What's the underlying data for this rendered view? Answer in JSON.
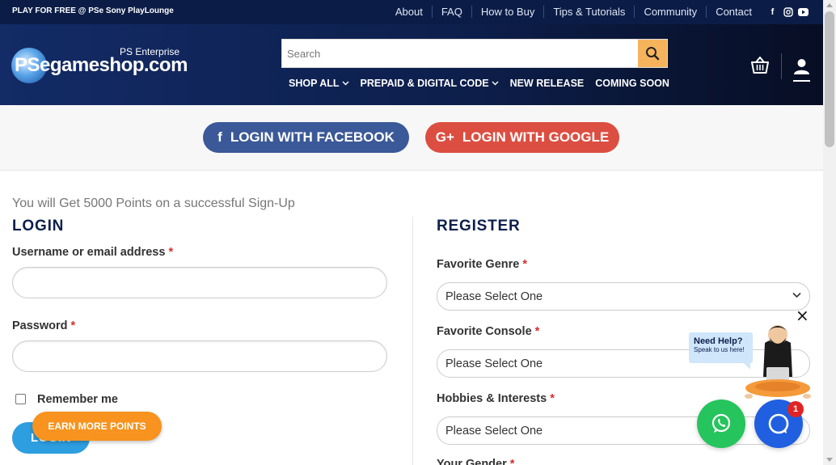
{
  "topbar": {
    "promo": "PLAY FOR FREE @ PSe Sony PlayLounge",
    "links": [
      "About",
      "FAQ",
      "How to Buy",
      "Tips & Tutorials",
      "Community",
      "Contact"
    ],
    "social": [
      "facebook-icon",
      "instagram-icon",
      "youtube-icon"
    ]
  },
  "header": {
    "logo_sub": "PS Enterprise",
    "logo_name": "PSegameshop.com",
    "search_placeholder": "Search",
    "nav": [
      "SHOP ALL",
      "PREPAID & DIGITAL CODE",
      "NEW RELEASE",
      "COMING SOON"
    ]
  },
  "social_login": {
    "facebook": "LOGIN WITH FACEBOOK",
    "google": "LOGIN WITH GOOGLE"
  },
  "points_note": "You will Get 5000 Points on a successful Sign-Up",
  "login": {
    "title": "LOGIN",
    "username_label": "Username or email address",
    "password_label": "Password",
    "required_mark": "*",
    "remember": "Remember me",
    "button": "LOGIN"
  },
  "earn_points": "EARN MORE POINTS",
  "register": {
    "title": "REGISTER",
    "genre_label": "Favorite Genre",
    "console_label": "Favorite Console",
    "hobbies_label": "Hobbies & Interests",
    "gender_label": "Your Gender",
    "select_placeholder": "Please Select One"
  },
  "help": {
    "title": "Need Help?",
    "subtitle": "Speak to us here!",
    "close": "×",
    "chat_badge": "1"
  },
  "colors": {
    "navy": "#0b1d47",
    "facebook": "#3b5998",
    "google": "#dc4e41",
    "search_button": "#f5b45c",
    "login_button": "#2d9ee0",
    "earn_button": "#f7931e",
    "whatsapp": "#25c45d",
    "chat": "#1f5fe0"
  }
}
